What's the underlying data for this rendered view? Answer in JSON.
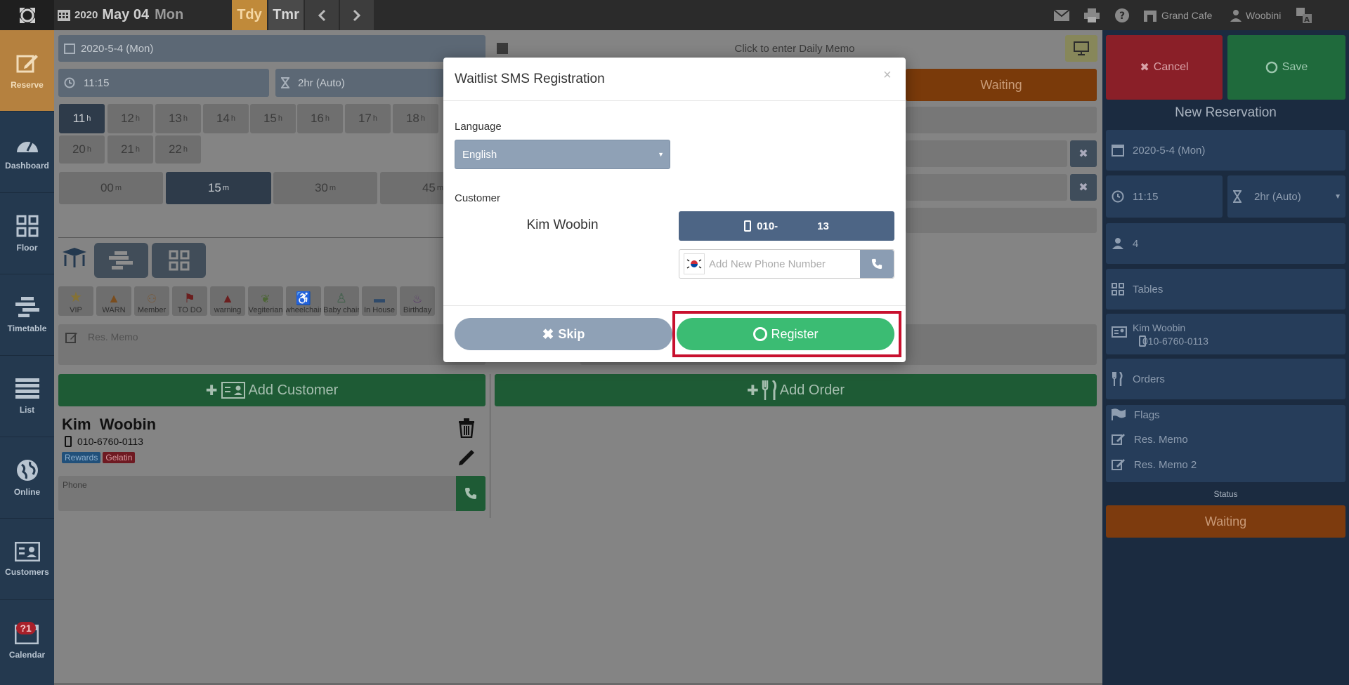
{
  "topbar": {
    "year": "2020",
    "month_day": "May 04",
    "weekday": "Mon",
    "today_label": "Tdy",
    "tomorrow_label": "Tmr",
    "store_name": "Grand Cafe",
    "user_name": "Woobini"
  },
  "nav": {
    "items": [
      {
        "label": "Reserve",
        "icon": "edit-icon"
      },
      {
        "label": "Dashboard",
        "icon": "gauge-icon"
      },
      {
        "label": "Floor",
        "icon": "grid-icon"
      },
      {
        "label": "Timetable",
        "icon": "timetable-icon"
      },
      {
        "label": "List",
        "icon": "list-icon"
      },
      {
        "label": "Online",
        "icon": "globe-icon"
      },
      {
        "label": "Customers",
        "icon": "id-card-icon"
      },
      {
        "label": "Calendar",
        "icon": "calendar-icon"
      }
    ],
    "calendar_badge": "?1"
  },
  "main": {
    "date_field": "2020-5-4 (Mon)",
    "time_field": "11:15",
    "duration_field": "2hr (Auto)",
    "daily_memo": "Click to enter Daily Memo",
    "status_waiting": "Waiting",
    "hours": [
      "11",
      "12",
      "13",
      "14",
      "15",
      "16",
      "17",
      "18",
      "20",
      "21",
      "22"
    ],
    "hour_suffix": "h",
    "minutes": [
      "00",
      "15",
      "30",
      "45"
    ],
    "minute_suffix": "m",
    "flags": [
      "VIP",
      "WARN",
      "Member",
      "TO DO",
      "warning",
      "Vegiterian",
      "wheelchair",
      "Baby chair",
      "In House",
      "Birthday"
    ],
    "res_memo_placeholder": "Res. Memo",
    "add_customer": "Add Customer",
    "add_order": "Add Order",
    "customer": {
      "name": "Kim  Woobin",
      "phone": "010-6760-0113",
      "tags": [
        "Rewards",
        "Gelatin"
      ],
      "phone_label": "Phone"
    }
  },
  "right_panel": {
    "cancel": "Cancel",
    "save": "Save",
    "title": "New Reservation",
    "date": "2020-5-4 (Mon)",
    "time": "11:15",
    "duration": "2hr (Auto)",
    "party_size": "4",
    "tables": "Tables",
    "customer_name": "Kim Woobin",
    "customer_phone": "010-6760-0113",
    "orders": "Orders",
    "flags": "Flags",
    "res_memo": "Res. Memo",
    "res_memo2": "Res. Memo 2",
    "status_label": "Status",
    "status_value": "Waiting"
  },
  "modal": {
    "title": "Waitlist SMS Registration",
    "close": "×",
    "language_label": "Language",
    "language_value": "English",
    "customer_label": "Customer",
    "customer_name": "Kim Woobin",
    "phone_prefix": "010-",
    "phone_suffix": "13",
    "phone_placeholder": "Add New Phone Number",
    "skip": "Skip",
    "register": "Register"
  },
  "colors": {
    "register_green": "#3bbc73",
    "skip_gray": "#8fa1b6",
    "highlight_red": "#c8102e",
    "waiting_orange": "#e8620a"
  }
}
